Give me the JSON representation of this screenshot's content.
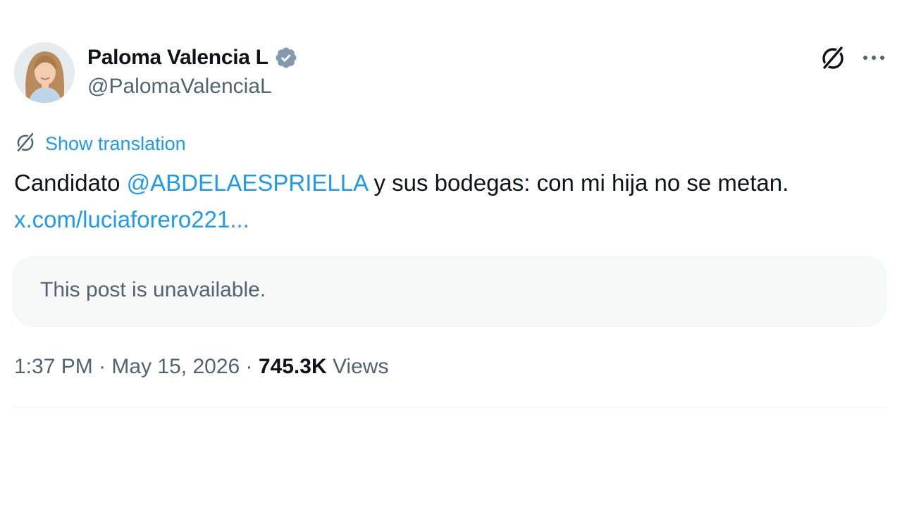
{
  "author": {
    "display_name": "Paloma Valencia L",
    "handle": "@PalomaValenciaL",
    "verified": true,
    "verified_color": "#829aab"
  },
  "translation": {
    "label": "Show translation"
  },
  "post": {
    "text_before": "Candidato ",
    "mention": "@ABDELAESPRIELLA",
    "text_after": " y sus bodegas: con mi hija no se metan.",
    "link": "x.com/luciaforero221..."
  },
  "quote": {
    "message": "This post is unavailable."
  },
  "meta": {
    "time": "1:37 PM",
    "separator": " · ",
    "date": "May 15, 2026",
    "views_count": "745.3K",
    "views_label": " Views"
  },
  "icons": {
    "grok": "grok-icon",
    "more": "more-icon",
    "translate": "translate-icon",
    "verified": "verified-badge-icon"
  },
  "colors": {
    "accent": "#1d9bf0",
    "text": "#0f1419",
    "secondary": "#536471"
  }
}
